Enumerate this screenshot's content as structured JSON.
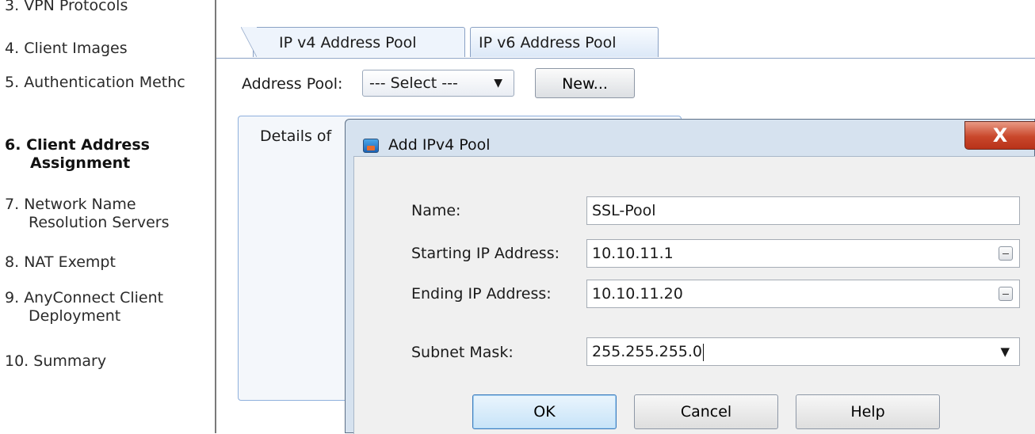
{
  "wizard_steps": {
    "items": [
      {
        "num": "3.",
        "label": "VPN Protocols",
        "cont": ""
      },
      {
        "num": "4.",
        "label": "Client Images",
        "cont": ""
      },
      {
        "num": "5.",
        "label": "Authentication Methc",
        "cont": ""
      },
      {
        "num": "6.",
        "label": "Client Address",
        "cont": "Assignment"
      },
      {
        "num": "7.",
        "label": "Network Name",
        "cont": "Resolution Servers"
      },
      {
        "num": "8.",
        "label": "NAT Exempt",
        "cont": ""
      },
      {
        "num": "9.",
        "label": "AnyConnect Client",
        "cont": "Deployment"
      },
      {
        "num": "10.",
        "label": "Summary",
        "cont": ""
      }
    ],
    "current_step": "6."
  },
  "tabs": {
    "ipv4": "IP v4 Address Pool",
    "ipv6": "IP v6 Address Pool",
    "active": "ipv4"
  },
  "address_pool": {
    "label": "Address Pool:",
    "selected": "--- Select ---",
    "new_button": "New..."
  },
  "details": {
    "label": "Details of"
  },
  "dialog": {
    "title": "Add IPv4 Pool",
    "close_glyph": "X",
    "fields": {
      "name": {
        "label": "Name:",
        "value": "SSL-Pool"
      },
      "start_ip": {
        "label": "Starting IP Address:",
        "value": "10.10.11.1"
      },
      "end_ip": {
        "label": "Ending IP Address:",
        "value": "10.10.11.20"
      },
      "subnet": {
        "label": "Subnet Mask:",
        "value": "255.255.255.0"
      }
    },
    "buttons": {
      "ok": "OK",
      "cancel": "Cancel",
      "help": "Help"
    }
  },
  "icons": {
    "dialog_icon": "network-pool-icon",
    "dropdown": "chevron-down-icon",
    "browse": "ellipsis-browse-icon"
  },
  "colors": {
    "close_button": "#c9472b",
    "tab_border": "#8aa1c4",
    "ok_focus": "#3d7bbd"
  }
}
